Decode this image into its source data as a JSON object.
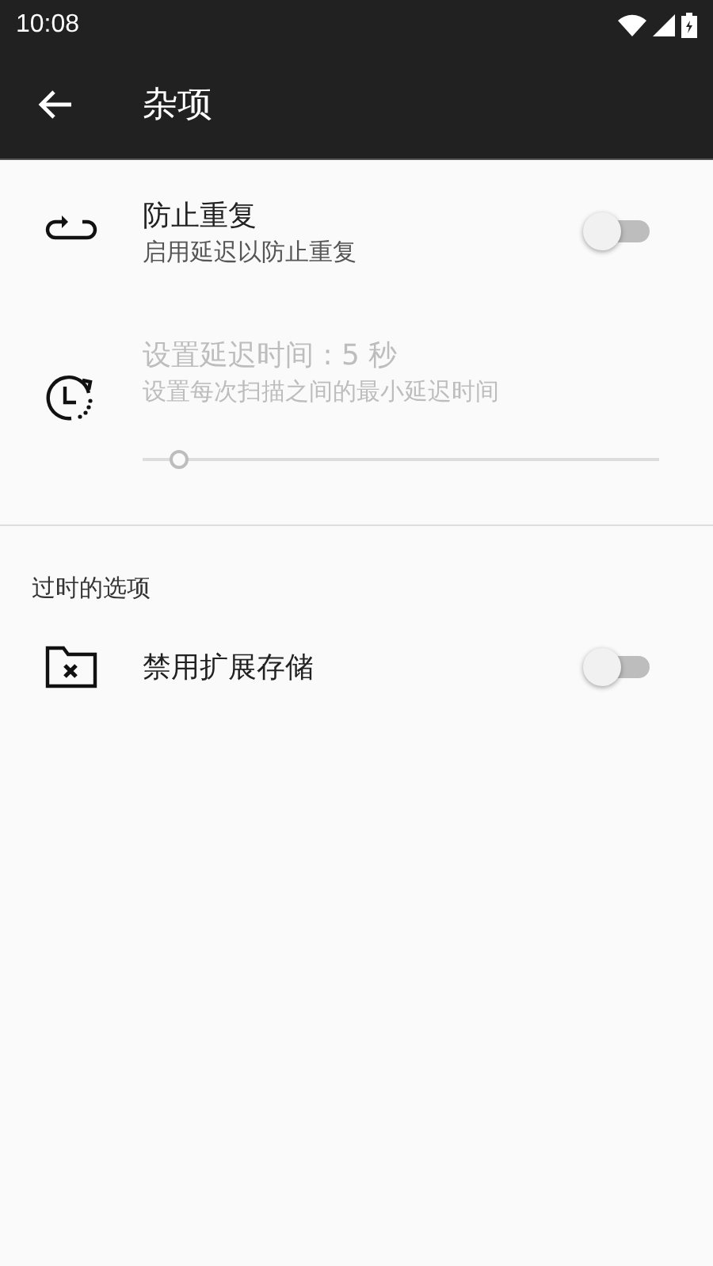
{
  "status_bar": {
    "time": "10:08"
  },
  "toolbar": {
    "title": "杂项"
  },
  "sections": [
    {
      "items": [
        {
          "kind": "switch",
          "title": "防止重复",
          "summary": "启用延迟以防止重复",
          "on": false,
          "disabled": false
        },
        {
          "kind": "slider",
          "title": "设置延迟时间 : 5 秒",
          "summary": "设置每次扫描之间的最小延迟时间",
          "level": 0.07,
          "disabled": true
        }
      ]
    },
    {
      "header": "过时的选项",
      "items": [
        {
          "kind": "switch",
          "title": "禁用扩展存储",
          "on": false,
          "disabled": false
        }
      ]
    }
  ]
}
